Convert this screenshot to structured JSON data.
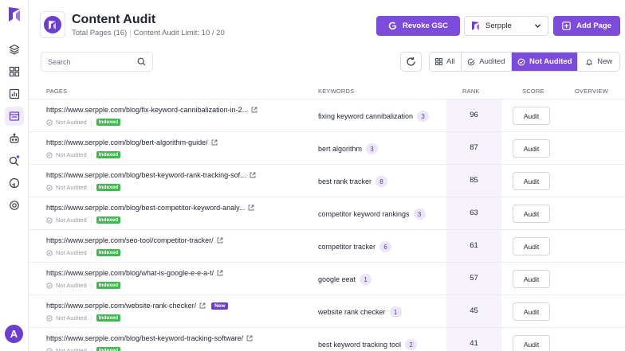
{
  "header": {
    "title": "Content Audit",
    "total_pages": "Total Pages (16)",
    "limit": "Content Audit Limit: 10 / 20",
    "revoke_label": "Revoke GSC",
    "project_name": "Serpple",
    "add_page_label": "Add Page"
  },
  "sidebar": {
    "avatar_letter": "A"
  },
  "toolbar": {
    "search_placeholder": "Search",
    "filters": {
      "all": "All",
      "audited": "Audited",
      "not_audited": "Not Audited",
      "new": "New"
    },
    "active_filter": "Not Audited"
  },
  "table": {
    "headers": {
      "pages": "PAGES",
      "keywords": "KEYWORDS",
      "rank": "RANK",
      "score": "SCORE",
      "overview": "OVERVIEW"
    },
    "status_label": "Not Audited",
    "indexed_label": "Indexed",
    "new_label": "New",
    "audit_label": "Audit",
    "rows": [
      {
        "url": "https://www.serpple.com/blog/fix-keyword-cannibalization-in-2...",
        "keyword": "fixing keyword cannibalization",
        "count": "3",
        "rank": "96"
      },
      {
        "url": "https://www.serpple.com/blog/bert-algorithm-guide/",
        "keyword": "bert algorithm",
        "count": "3",
        "rank": "87"
      },
      {
        "url": "https://www.serpple.com/blog/best-keyword-rank-tracking-sof...",
        "keyword": "best rank tracker",
        "count": "8",
        "rank": "85"
      },
      {
        "url": "https://www.serpple.com/blog/best-competitor-keyword-analy...",
        "keyword": "competitor keyword rankings",
        "count": "3",
        "rank": "63"
      },
      {
        "url": "https://www.serpple.com/seo-tool/competitor-tracker/",
        "keyword": "competitor tracker",
        "count": "6",
        "rank": "61"
      },
      {
        "url": "https://www.serpple.com/blog/what-is-google-e-e-a-t/",
        "keyword": "google eeat",
        "count": "1",
        "rank": "57"
      },
      {
        "url": "https://www.serpple.com/website-rank-checker/",
        "keyword": "website rank checker",
        "count": "1",
        "rank": "45",
        "is_new": true
      },
      {
        "url": "https://www.serpple.com/blog/best-keyword-tracking-software/",
        "keyword": "best keyword tracking tool",
        "count": "2",
        "rank": "41"
      }
    ]
  },
  "colors": {
    "accent": "#7c4cdc",
    "indexed": "#3fba4f",
    "new_badge": "#6c3dd1"
  }
}
